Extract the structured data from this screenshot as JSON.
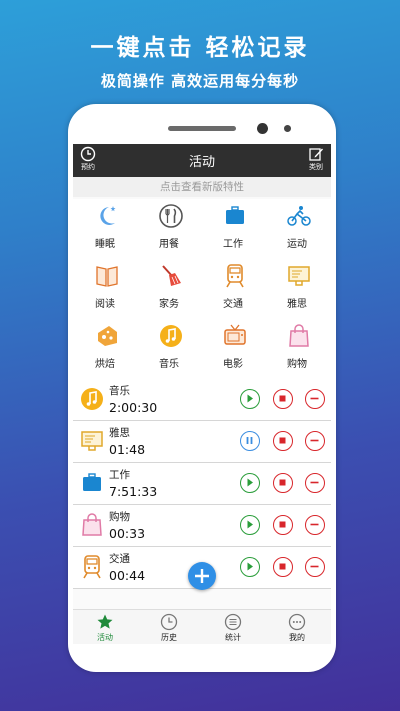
{
  "promo": {
    "headline": "一键点击  轻松记录",
    "subline": "极简操作 高效运用每分每秒"
  },
  "topbar": {
    "title": "活动",
    "left_label": "预约",
    "right_label": "类别"
  },
  "notice": "点击查看新版特性",
  "categories": [
    {
      "label": "睡眠",
      "icon": "moon-stars-icon"
    },
    {
      "label": "用餐",
      "icon": "fork-knife-icon"
    },
    {
      "label": "工作",
      "icon": "briefcase-icon"
    },
    {
      "label": "运动",
      "icon": "cyclist-icon"
    },
    {
      "label": "阅读",
      "icon": "book-icon"
    },
    {
      "label": "家务",
      "icon": "broom-icon"
    },
    {
      "label": "交通",
      "icon": "train-icon"
    },
    {
      "label": "雅思",
      "icon": "monitor-icon"
    },
    {
      "label": "烘焙",
      "icon": "cheese-icon"
    },
    {
      "label": "音乐",
      "icon": "music-note-icon"
    },
    {
      "label": "电影",
      "icon": "tv-icon"
    },
    {
      "label": "购物",
      "icon": "shopping-bag-icon"
    }
  ],
  "activities": [
    {
      "name": "音乐",
      "time": "2:00:30",
      "state": "running"
    },
    {
      "name": "雅思",
      "time": "01:48",
      "state": "running"
    },
    {
      "name": "工作",
      "time": "7:51:33",
      "state": "paused"
    },
    {
      "name": "购物",
      "time": "00:33",
      "state": "paused"
    },
    {
      "name": "交通",
      "time": "00:44",
      "state": "paused"
    }
  ],
  "tabs": [
    {
      "label": "活动",
      "icon": "star-icon",
      "active": true
    },
    {
      "label": "历史",
      "icon": "clock-icon",
      "active": false
    },
    {
      "label": "统计",
      "icon": "list-icon",
      "active": false
    },
    {
      "label": "我的",
      "icon": "more-dots-icon",
      "active": false
    }
  ],
  "colors": {
    "accent_green": "#2a9d3a",
    "stop_red": "#d8262b",
    "pause_blue": "#3b8de0",
    "fab_blue": "#2f8fe6",
    "topbar_dark": "#2f2f2f"
  }
}
